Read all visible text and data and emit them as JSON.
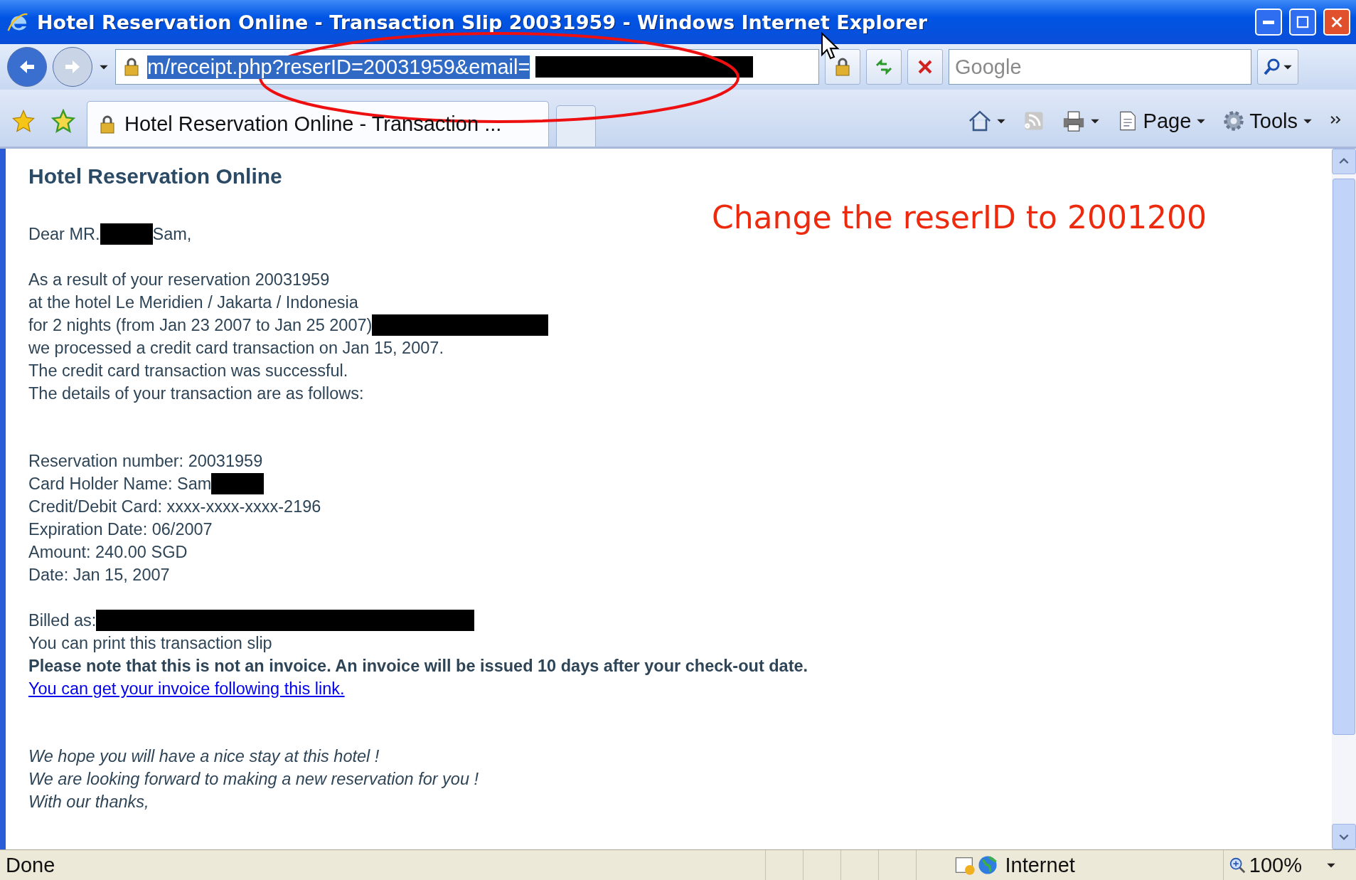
{
  "window": {
    "title": "Hotel Reservation Online - Transaction Slip 20031959 - Windows Internet Explorer"
  },
  "address_bar": {
    "value": "m/receipt.php?reserID=20031959&email="
  },
  "search": {
    "placeholder": "Google"
  },
  "tabs": [
    {
      "label": "Hotel Reservation Online - Transaction ...",
      "selected": true
    }
  ],
  "command_bar": [
    "Page",
    "Tools"
  ],
  "page": {
    "heading": "Hotel Reservation Online",
    "sections": [
      [
        {
          "parts": [
            {
              "kind": "text",
              "text": "Dear MR."
            },
            {
              "kind": "redaction"
            },
            {
              "kind": "text",
              "text": "Sam,"
            }
          ]
        }
      ],
      [
        {
          "parts": [
            {
              "kind": "text",
              "text": "As a result of your reservation 20031959"
            }
          ]
        },
        {
          "parts": [
            {
              "kind": "text",
              "text": "at the hotel Le Meridien / Jakarta / Indonesia"
            }
          ]
        },
        {
          "parts": [
            {
              "kind": "text",
              "text": "for 2 nights (from Jan 23 2007 to Jan 25 2007)"
            },
            {
              "kind": "redaction"
            }
          ]
        },
        {
          "parts": [
            {
              "kind": "text",
              "text": "we processed a credit card transaction on Jan 15, 2007."
            }
          ]
        },
        {
          "parts": [
            {
              "kind": "text",
              "text": "The credit card transaction was successful."
            }
          ]
        },
        {
          "parts": [
            {
              "kind": "text",
              "text": "The details of your transaction are as follows:"
            }
          ]
        }
      ],
      [
        {
          "parts": [
            {
              "kind": "text",
              "text": "Reservation number: 20031959"
            }
          ]
        },
        {
          "parts": [
            {
              "kind": "text",
              "text": "Card Holder Name: Sam"
            },
            {
              "kind": "redaction"
            }
          ]
        },
        {
          "parts": [
            {
              "kind": "text",
              "text": "Credit/Debit Card: xxxx-xxxx-xxxx-2196"
            }
          ]
        },
        {
          "parts": [
            {
              "kind": "text",
              "text": "Expiration Date: 06/2007"
            }
          ]
        },
        {
          "parts": [
            {
              "kind": "text",
              "text": "Amount: 240.00 SGD"
            }
          ]
        },
        {
          "parts": [
            {
              "kind": "text",
              "text": "Date: Jan 15, 2007"
            }
          ]
        }
      ],
      [
        {
          "parts": [
            {
              "kind": "text",
              "text": "Billed as:"
            },
            {
              "kind": "redaction"
            }
          ]
        },
        {
          "parts": [
            {
              "kind": "text",
              "text": "You can print this transaction slip"
            }
          ]
        },
        {
          "parts": [
            {
              "kind": "bold",
              "text": "Please note that this is not an invoice. An invoice will be issued 10 days after your check-out date."
            }
          ]
        },
        {
          "parts": [
            {
              "kind": "link",
              "text": "You can get your invoice following this link."
            }
          ]
        }
      ],
      [
        {
          "parts": [
            {
              "kind": "italic",
              "text": "We hope you will have a nice stay at this hotel !"
            }
          ]
        },
        {
          "parts": [
            {
              "kind": "italic",
              "text": "We are looking forward to making a new reservation for you !"
            }
          ]
        },
        {
          "parts": [
            {
              "kind": "italic",
              "text": "With our thanks,"
            }
          ]
        }
      ]
    ]
  },
  "annotation": {
    "text": "Change the reserID to 2001200"
  },
  "status_bar": {
    "status": "Done",
    "zone": "Internet",
    "zoom": "100%"
  }
}
